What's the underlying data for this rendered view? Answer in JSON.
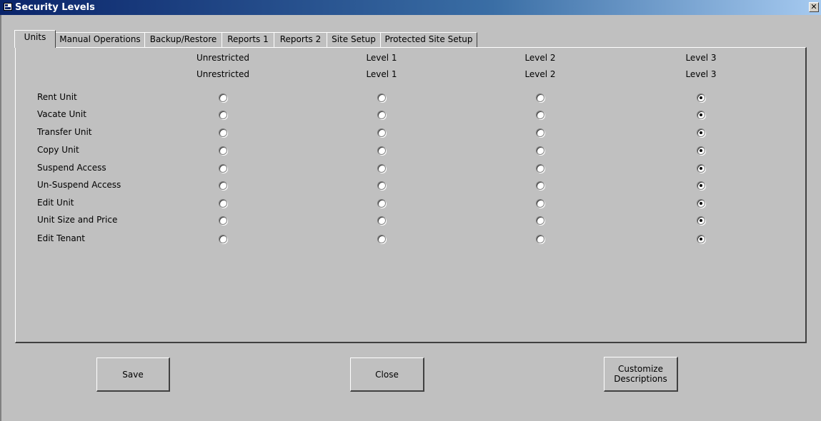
{
  "window": {
    "title": "Security Levels",
    "close_symbol": "✕"
  },
  "tabs": [
    {
      "label": "Units",
      "active": true
    },
    {
      "label": "Manual Operations",
      "active": false
    },
    {
      "label": "Backup/Restore",
      "active": false
    },
    {
      "label": "Reports 1",
      "active": false
    },
    {
      "label": "Reports 2",
      "active": false
    },
    {
      "label": "Site Setup",
      "active": false
    },
    {
      "label": "Protected Site Setup",
      "active": false
    }
  ],
  "levels": {
    "headers": [
      "Unrestricted",
      "Level 1",
      "Level 2",
      "Level 3"
    ],
    "descriptions": [
      "Unrestricted",
      "Level 1",
      "Level 2",
      "Level 3"
    ]
  },
  "operations": [
    {
      "label": "Rent Unit",
      "selected": 3
    },
    {
      "label": "Vacate Unit",
      "selected": 3
    },
    {
      "label": "Transfer Unit",
      "selected": 3
    },
    {
      "label": "Copy Unit",
      "selected": 3
    },
    {
      "label": "Suspend Access",
      "selected": 3
    },
    {
      "label": "Un-Suspend Access",
      "selected": 3
    },
    {
      "label": "Edit Unit",
      "selected": 3
    },
    {
      "label": "Unit Size and Price",
      "selected": 3
    },
    {
      "label": "Edit Tenant",
      "selected": 3
    }
  ],
  "buttons": {
    "save": "Save",
    "close": "Close",
    "customize": "Customize\nDescriptions"
  },
  "icons": {
    "window": "form-icon",
    "close": "close-icon"
  }
}
